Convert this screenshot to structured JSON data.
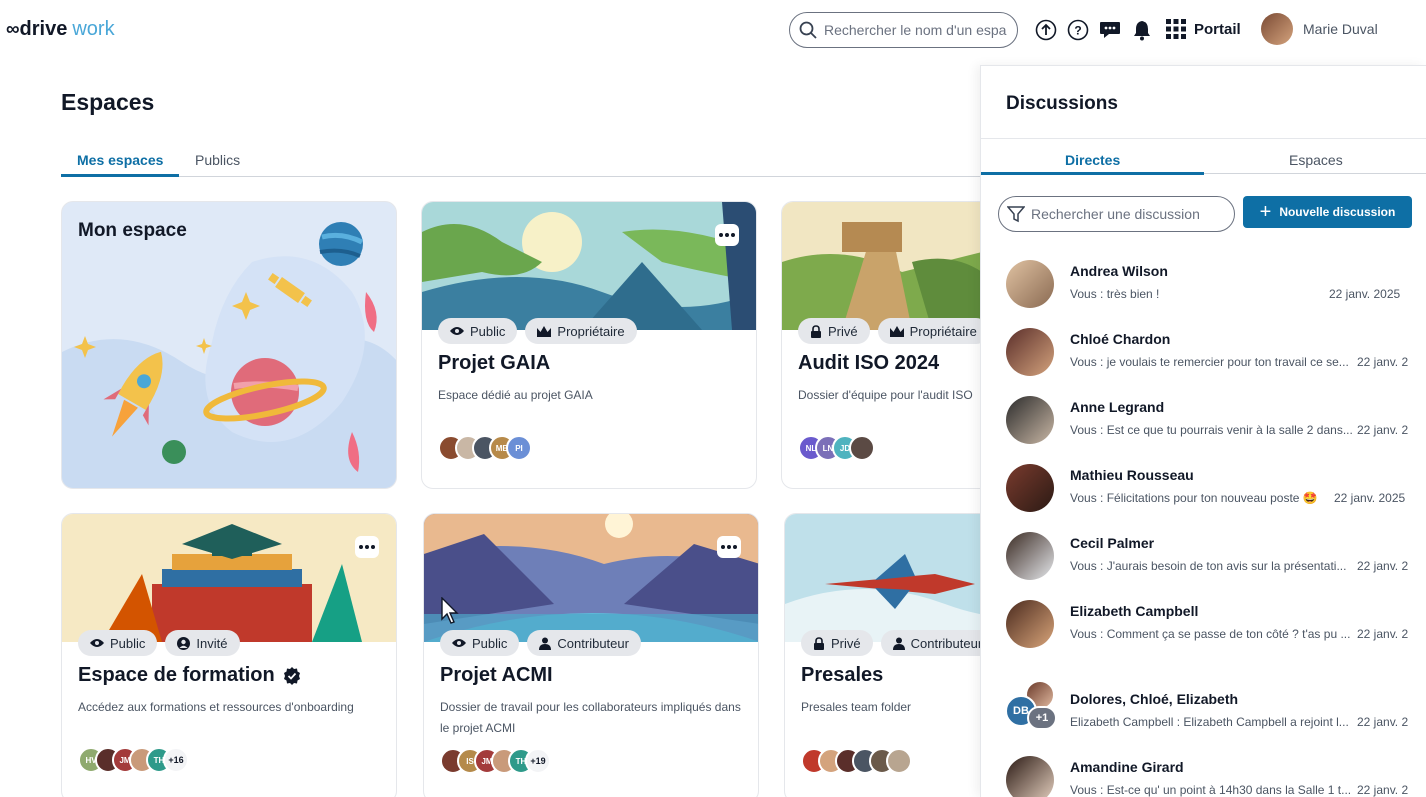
{
  "header": {
    "logo_mark": "∞",
    "logo_brand": "drive",
    "logo_product": "work",
    "search_placeholder": "Rechercher le nom d'un espa",
    "portail_label": "Portail",
    "user_name": "Marie Duval"
  },
  "main": {
    "title": "Espaces",
    "tabs": [
      {
        "label": "Mes espaces",
        "active": true
      },
      {
        "label": "Publics",
        "active": false
      }
    ]
  },
  "cards": [
    {
      "title": "Mon espace"
    },
    {
      "title": "Projet GAIA",
      "visibility": "Public",
      "role": "Propriétaire",
      "description": "Espace dédié au projet GAIA",
      "avatars": [
        "",
        "",
        "",
        "MB",
        "PI"
      ]
    },
    {
      "title": "Audit ISO 2024",
      "visibility": "Privé",
      "role": "Propriétaire",
      "description": "Dossier d'équipe pour l'audit ISO",
      "avatars": [
        "NL",
        "LN",
        "JD",
        ""
      ]
    },
    {
      "title": "Espace de formation",
      "visibility": "Public",
      "role": "Invité",
      "description": "Accédez aux formations et ressources d'onboarding",
      "avatars": [
        "HV",
        "",
        "JM",
        "",
        "TH"
      ],
      "more": "+16"
    },
    {
      "title": "Projet ACMI",
      "visibility": "Public",
      "role": "Contributeur",
      "description": "Dossier de travail pour les collaborateurs impliqués dans le projet ACMI",
      "avatars": [
        "",
        "IS",
        "JM",
        "",
        "TH"
      ],
      "more": "+19"
    },
    {
      "title": "Presales",
      "visibility": "Privé",
      "role": "Contributeur",
      "description": "Presales team folder",
      "avatars": [
        "",
        "",
        "",
        "",
        "",
        ""
      ]
    }
  ],
  "discussions": {
    "title": "Discussions",
    "tabs": [
      {
        "label": "Directes",
        "active": true
      },
      {
        "label": "Espaces",
        "active": false
      }
    ],
    "search_placeholder": "Rechercher une discussion",
    "new_button": "Nouvelle discussion",
    "items": [
      {
        "name": "Andrea Wilson",
        "message": "Vous : très bien !",
        "date": "22 janv. 2025"
      },
      {
        "name": "Chloé Chardon",
        "message": "Vous : je voulais te remercier pour ton travail ce se...",
        "date": "22 janv. 2"
      },
      {
        "name": "Anne Legrand",
        "message": "Vous : Est ce que tu pourrais venir à la salle 2 dans...",
        "date": "22 janv. 2"
      },
      {
        "name": "Mathieu Rousseau",
        "message": "Vous : Félicitations pour ton nouveau poste 🤩",
        "date": "22 janv. 2025"
      },
      {
        "name": "Cecil Palmer",
        "message": "Vous : J'aurais besoin de ton avis sur la présentati...",
        "date": "22 janv. 2"
      },
      {
        "name": "Elizabeth Campbell",
        "message": "Vous : Comment ça se passe de ton côté ? t'as pu ...",
        "date": "22 janv. 2"
      },
      {
        "name": "Dolores, Chloé, Elizabeth",
        "message": "Elizabeth Campbell : Elizabeth Campbell a rejoint l...",
        "date": "22 janv. 2",
        "group_initials": "DB",
        "group_more": "+1"
      },
      {
        "name": "Amandine Girard",
        "message": "Vous : Est-ce qu' un point à 14h30 dans la Salle 1 t...",
        "date": "22 janv. 2"
      }
    ]
  }
}
